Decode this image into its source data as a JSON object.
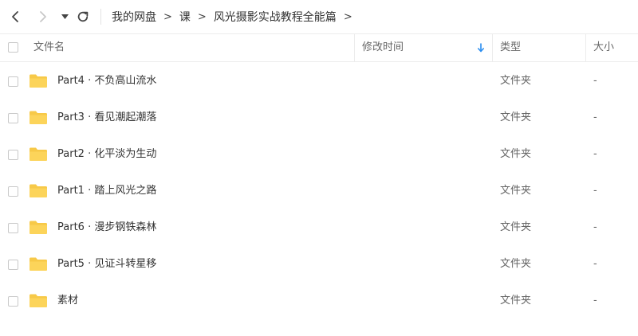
{
  "breadcrumb": {
    "items": [
      {
        "label": "我的网盘"
      },
      {
        "label": "课"
      },
      {
        "label": "风光摄影实战教程全能篇"
      }
    ],
    "separator": ">"
  },
  "table": {
    "headers": {
      "name": "文件名",
      "modified": "修改时间",
      "type": "类型",
      "size": "大小"
    },
    "sort_column": "modified",
    "rows": [
      {
        "name": "Part4 · 不负高山流水",
        "type": "文件夹",
        "size": "-"
      },
      {
        "name": "Part3 · 看见潮起潮落",
        "type": "文件夹",
        "size": "-"
      },
      {
        "name": "Part2 · 化平淡为生动",
        "type": "文件夹",
        "size": "-"
      },
      {
        "name": "Part1 · 踏上风光之路",
        "type": "文件夹",
        "size": "-"
      },
      {
        "name": "Part6 · 漫步钢铁森林",
        "type": "文件夹",
        "size": "-"
      },
      {
        "name": "Part5 · 见证斗转星移",
        "type": "文件夹",
        "size": "-"
      },
      {
        "name": "素材",
        "type": "文件夹",
        "size": "-"
      }
    ]
  },
  "icons": {
    "back": "chevron-left-icon",
    "forward": "chevron-right-icon",
    "history": "caret-down-icon",
    "refresh": "refresh-icon",
    "folder": "folder-icon",
    "sort": "arrow-down-icon"
  },
  "colors": {
    "folder": "#f7c948",
    "sort_arrow": "#2b8ef0",
    "forward_disabled": "#c8c8c8"
  }
}
